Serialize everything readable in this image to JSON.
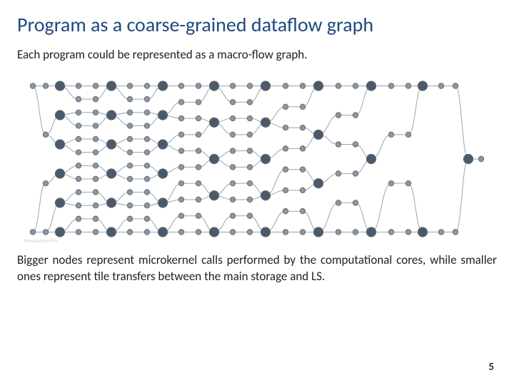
{
  "slide": {
    "title": "Program as a coarse-grained dataflow graph",
    "subtitle": "Each program could be represented as a macro-flow graph.",
    "description": "Bigger nodes represent microkernel calls performed by the computational cores, while smaller ones represent tile transfers between the main storage and LS.",
    "page_number": "5",
    "watermark": "Powered by POV",
    "figure": {
      "type": "dataflow-graph",
      "node_fill_big": "#4a5a6a",
      "node_fill_small": "#8a97a3",
      "edge_color": "#9aa4ae",
      "big_radius": 6.5,
      "small_radius": 3.8
    }
  }
}
